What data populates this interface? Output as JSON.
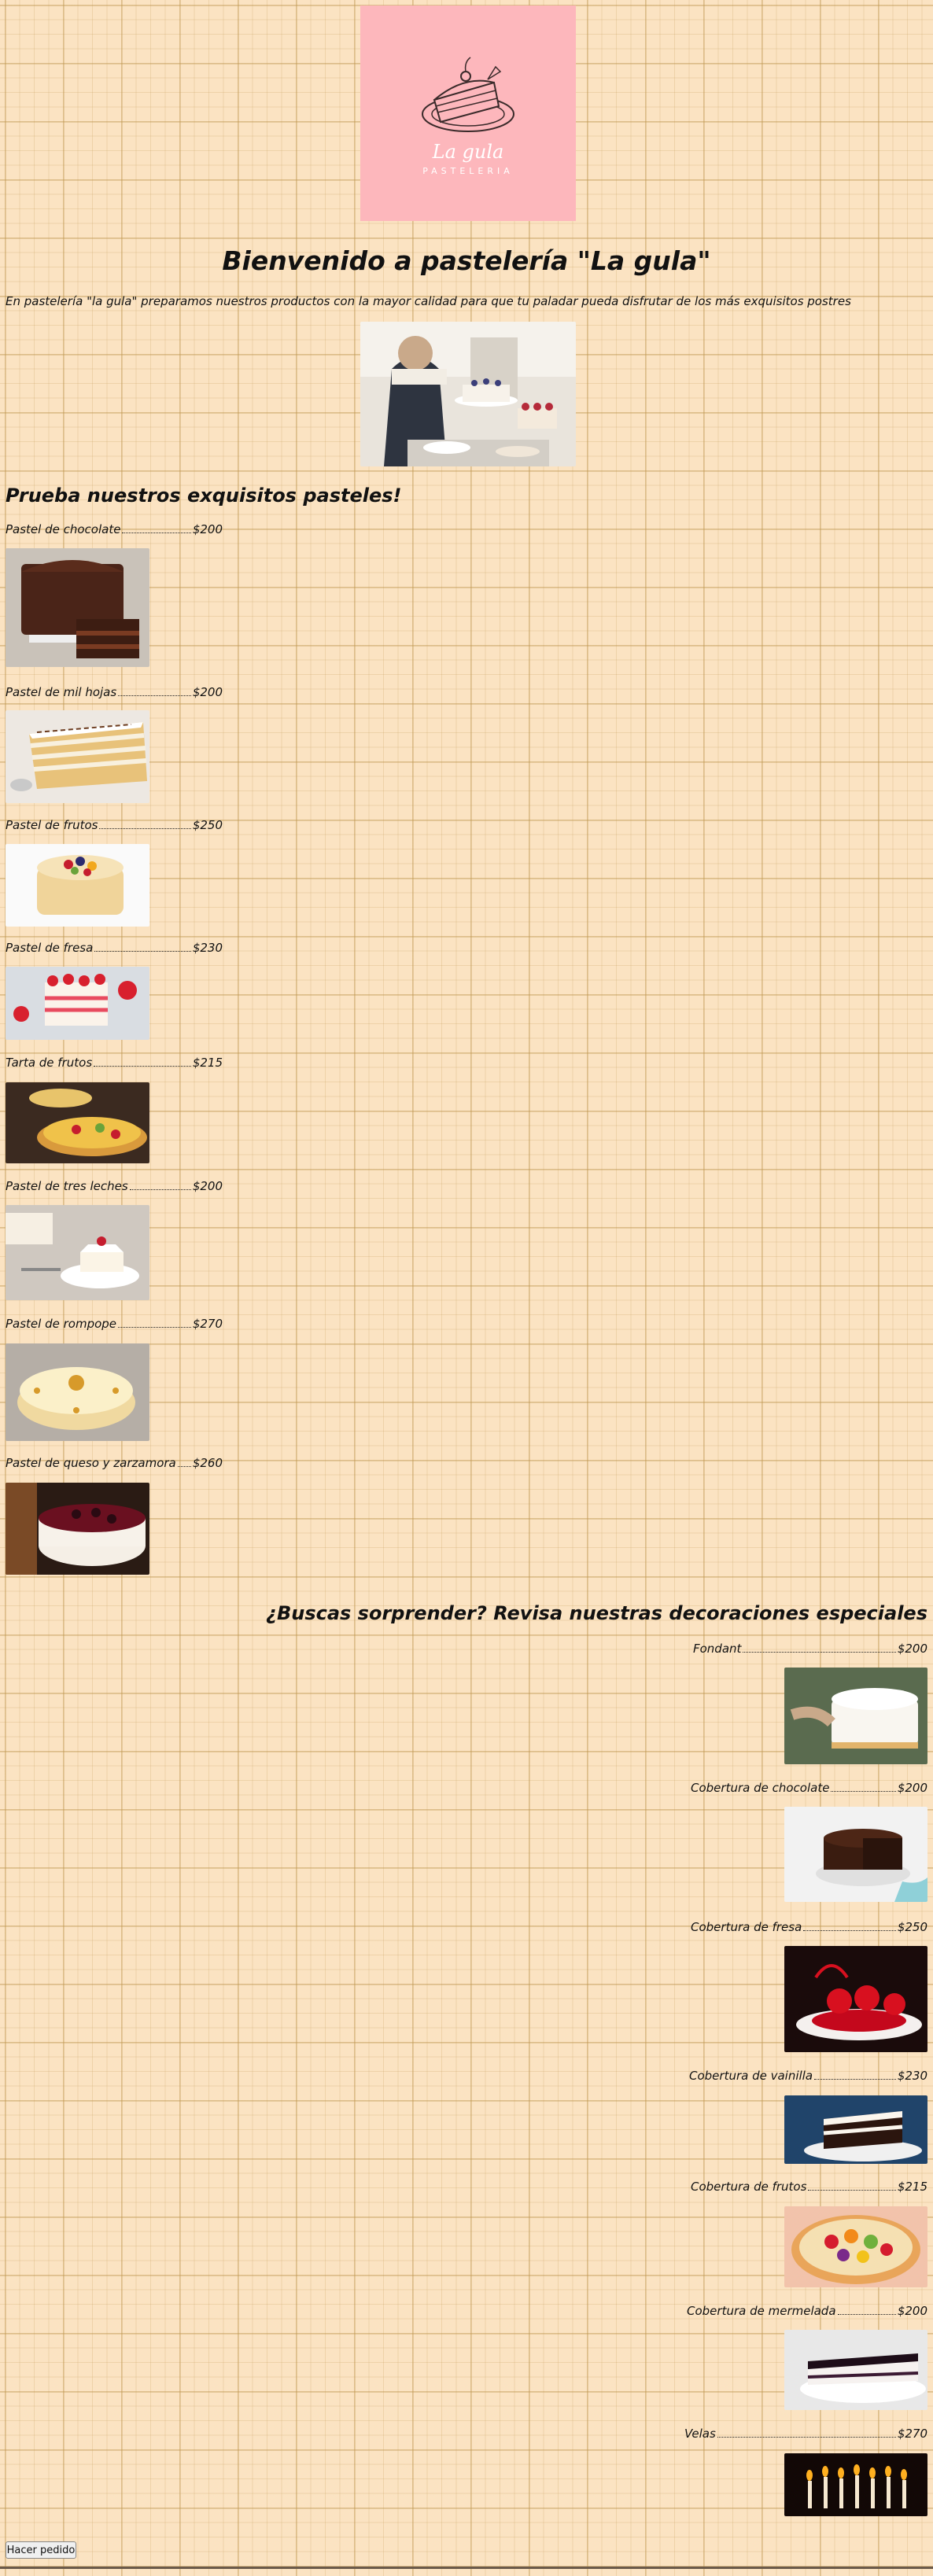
{
  "logo": {
    "name": "La gula",
    "sub": "PASTELERIA",
    "icon": "cake-slice-icon"
  },
  "title": "Bienvenido a pastelería \"La gula\"",
  "intro": "En pastelería \"la gula\" preparamos nuestros productos con la mayor calidad para que tu paladar pueda disfrutar de los más exquisitos postres",
  "cakes_heading": "Prueba nuestros exquisitos pasteles!",
  "cakes": [
    {
      "name": "Pastel de chocolate",
      "price": "$200"
    },
    {
      "name": "Pastel de mil hojas",
      "price": "$200"
    },
    {
      "name": "Pastel de frutos",
      "price": "$250"
    },
    {
      "name": "Pastel de fresa",
      "price": "$230"
    },
    {
      "name": "Tarta de frutos",
      "price": "$215"
    },
    {
      "name": "Pastel de tres leches",
      "price": "$200"
    },
    {
      "name": "Pastel de rompope",
      "price": "$270"
    },
    {
      "name": "Pastel de queso y zarzamora",
      "price": "$260"
    }
  ],
  "decor_heading": "¿Buscas sorprender? Revisa nuestras decoraciones especiales",
  "decorations": [
    {
      "name": "Fondant",
      "price": "$200"
    },
    {
      "name": "Cobertura de chocolate",
      "price": "$200"
    },
    {
      "name": "Cobertura de fresa",
      "price": "$250"
    },
    {
      "name": "Cobertura de vainilla",
      "price": "$230"
    },
    {
      "name": "Cobertura de frutos",
      "price": "$215"
    },
    {
      "name": "Cobertura de mermelada",
      "price": "$200"
    },
    {
      "name": "Velas",
      "price": "$270"
    }
  ],
  "order_button": "Hacer pedido",
  "colors": {
    "background": "#fbe3c2",
    "logo_bg": "#fdb7bc",
    "pattern": "#be9650"
  }
}
